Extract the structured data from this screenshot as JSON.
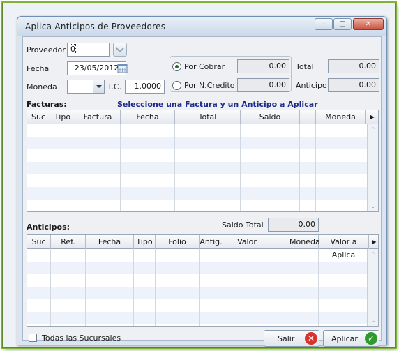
{
  "window": {
    "title": "Aplica Anticipos de Proveedores"
  },
  "header": {
    "proveedor_label": "Proveedor",
    "proveedor_value": "0",
    "fecha_label": "Fecha",
    "fecha_value": "23/05/2012",
    "moneda_label": "Moneda",
    "moneda_value": "",
    "tc_label": "T.C.",
    "tc_value": "1.0000",
    "por_cobrar_label": "Por Cobrar",
    "por_cobrar_value": "0.00",
    "por_ncredito_label": "Por N.Credito",
    "por_ncredito_value": "0.00",
    "total_label": "Total",
    "total_value": "0.00",
    "anticipo_label": "Anticipo",
    "anticipo_value": "0.00"
  },
  "facturas": {
    "label": "Facturas:",
    "instruction": "Seleccione una Factura y un Anticipo a Aplicar",
    "columns": [
      "Suc",
      "Tipo",
      "Factura",
      "Fecha",
      "Total",
      "Saldo",
      "",
      "Moneda"
    ]
  },
  "anticipos": {
    "label": "Anticipos:",
    "saldo_total_label": "Saldo Total",
    "saldo_total_value": "0.00",
    "columns": [
      "Suc",
      "Ref.",
      "Fecha",
      "Tipo",
      "Folio",
      "Antig.",
      "Valor",
      "",
      "Moneda",
      "Valor a Aplica"
    ]
  },
  "footer": {
    "todas_sucursales_label": "Todas las Sucursales",
    "salir_label": "Salir",
    "aplicar_label": "Aplicar"
  },
  "icons": {
    "minimize": "minimize-icon",
    "maximize": "maximize-icon",
    "close": "close-icon",
    "calendar": "calendar-icon",
    "salir": "cancel-x-icon",
    "aplicar": "check-icon"
  },
  "colors": {
    "heading_blue": "#1f2b8a",
    "cancel_red": "#d9342b",
    "ok_green": "#2f9b2a",
    "row_alt": "#eef2fb"
  }
}
